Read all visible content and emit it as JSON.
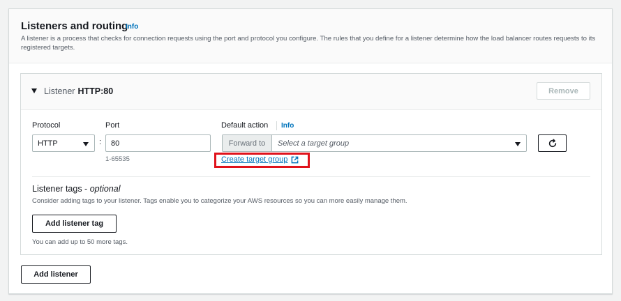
{
  "section": {
    "title": "Listeners and routing",
    "info": "Info",
    "description": "A listener is a process that checks for connection requests using the port and protocol you configure. The rules that you define for a listener determine how the load balancer routes requests to its registered targets."
  },
  "listener": {
    "label": "Listener",
    "name": "HTTP:80",
    "remove_label": "Remove",
    "protocol_label": "Protocol",
    "protocol_value": "HTTP",
    "port_label": "Port",
    "port_value": "80",
    "port_hint": "1-65535",
    "default_action_label": "Default action",
    "default_action_info": "Info",
    "forward_to_label": "Forward to",
    "target_group_placeholder": "Select a target group",
    "create_target_group": "Create target group"
  },
  "tags": {
    "title": "Listener tags - ",
    "title_optional": "optional",
    "description": "Consider adding tags to your listener. Tags enable you to categorize your AWS resources so you can more easily manage them.",
    "add_button": "Add listener tag",
    "hint": "You can add up to 50 more tags."
  },
  "add_listener_label": "Add listener",
  "icons": [
    "caret-down-icon",
    "chevron-down-icon",
    "refresh-icon",
    "external-link-icon"
  ],
  "colors": {
    "link": "#0073bb",
    "highlight": "#e0121b"
  }
}
